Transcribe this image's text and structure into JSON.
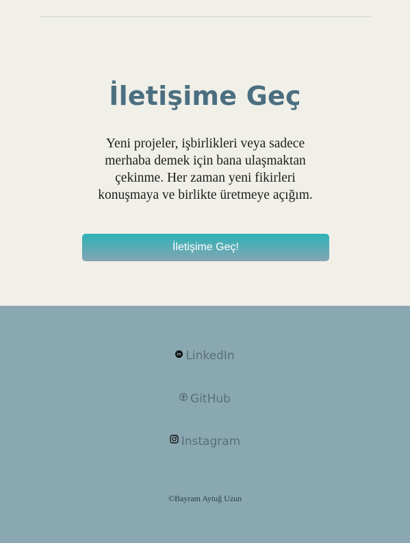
{
  "contact": {
    "title": "İletişime Geç",
    "description": "Yeni projeler, işbirlikleri veya sadece merhaba demek için bana ulaşmaktan çekinme. Her zaman yeni fikirleri konuşmaya ve birlikte üretmeye açığım.",
    "button_label": "İletişime Geç!"
  },
  "footer": {
    "links": [
      {
        "label": "LinkedIn",
        "icon": "linkedin-icon"
      },
      {
        "label": "GitHub",
        "icon": "github-icon"
      },
      {
        "label": "Instagram",
        "icon": "instagram-icon"
      }
    ],
    "copyright": "©Bayram Aytuğ Uzun"
  },
  "colors": {
    "background": "#f0efe8",
    "title": "#4b6f80",
    "button_top": "#2fb3b8",
    "button_bottom": "#85a6b0",
    "footer": "#8aa8b1"
  }
}
